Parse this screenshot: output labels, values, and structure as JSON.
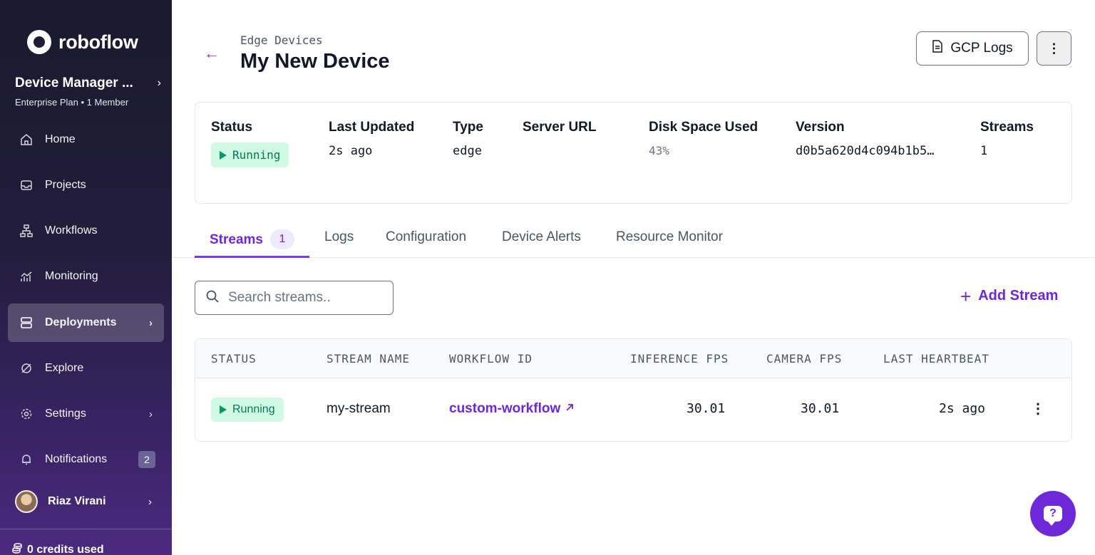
{
  "sidebar": {
    "brand": "roboflow",
    "workspace": {
      "name": "Device Manager ...",
      "subtitle": "Enterprise Plan • 1 Member"
    },
    "items": [
      {
        "label": "Home",
        "icon": "home-icon"
      },
      {
        "label": "Projects",
        "icon": "projects-icon"
      },
      {
        "label": "Workflows",
        "icon": "workflows-icon"
      },
      {
        "label": "Monitoring",
        "icon": "monitoring-icon"
      },
      {
        "label": "Deployments",
        "icon": "deployments-icon",
        "active": true
      },
      {
        "label": "Explore",
        "icon": "explore-icon"
      },
      {
        "label": "Settings",
        "icon": "gear-icon"
      },
      {
        "label": "Notifications",
        "icon": "bell-icon",
        "badge": "2"
      }
    ],
    "user": {
      "name": "Riaz Virani"
    },
    "credits": "0 credits used"
  },
  "header": {
    "breadcrumb": "Edge Devices",
    "title": "My New Device",
    "gcp_logs_label": "GCP Logs",
    "more_label": "⋮"
  },
  "device_info": {
    "status_label": "Status",
    "status_value": "Running",
    "last_updated_label": "Last Updated",
    "last_updated_value": "2s ago",
    "type_label": "Type",
    "type_value": "edge",
    "server_url_label": "Server URL",
    "server_url_value": "",
    "disk_label": "Disk Space Used",
    "disk_value": "43%",
    "version_label": "Version",
    "version_value": "d0b5a620d4c094b1b5…",
    "streams_label": "Streams",
    "streams_value": "1"
  },
  "tabs": [
    {
      "label": "Streams",
      "count": "1",
      "active": true
    },
    {
      "label": "Logs"
    },
    {
      "label": "Configuration"
    },
    {
      "label": "Device Alerts"
    },
    {
      "label": "Resource Monitor"
    }
  ],
  "search": {
    "placeholder": "Search streams..",
    "value": ""
  },
  "add_stream_label": "Add Stream",
  "table": {
    "columns": [
      "STATUS",
      "STREAM NAME",
      "WORKFLOW ID",
      "INFERENCE FPS",
      "CAMERA FPS",
      "LAST HEARTBEAT"
    ],
    "rows": [
      {
        "status": "Running",
        "stream_name": "my-stream",
        "workflow_id": "custom-workflow",
        "inference_fps": "30.01",
        "camera_fps": "30.01",
        "last_heartbeat": "2s ago"
      }
    ]
  },
  "colors": {
    "accent": "#6d28d9",
    "running_bg": "#d1fae5",
    "running_fg": "#047857"
  }
}
